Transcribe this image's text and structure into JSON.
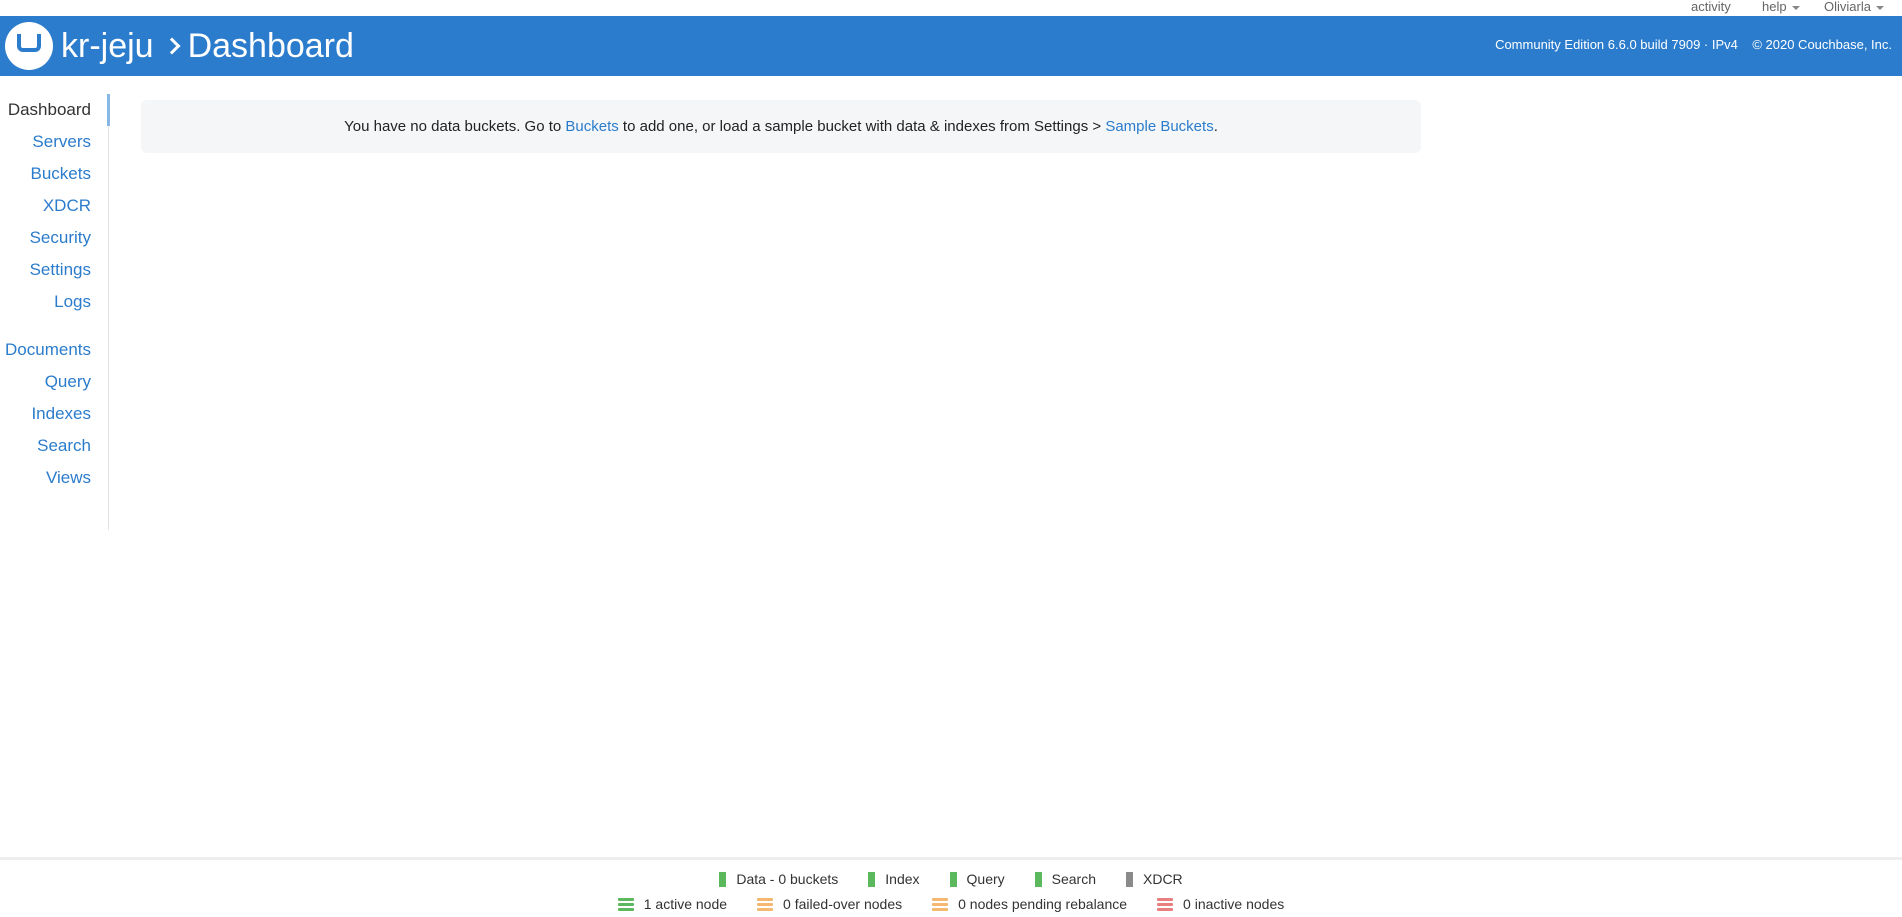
{
  "topbar": {
    "activity": "activity",
    "help": "help",
    "user": "Oliviarla"
  },
  "header": {
    "cluster_name": "kr-jeju",
    "page_title": "Dashboard",
    "version_info": "Community Edition 6.6.0 build 7909 · IPv4",
    "copyright": "© 2020 Couchbase, Inc.",
    "brand_color": "#2b7ccc"
  },
  "sidebar": {
    "group1": [
      {
        "label": "Dashboard",
        "active": true
      },
      {
        "label": "Servers"
      },
      {
        "label": "Buckets"
      },
      {
        "label": "XDCR"
      },
      {
        "label": "Security"
      },
      {
        "label": "Settings"
      },
      {
        "label": "Logs"
      }
    ],
    "group2": [
      {
        "label": "Documents"
      },
      {
        "label": "Query"
      },
      {
        "label": "Indexes"
      },
      {
        "label": "Search"
      },
      {
        "label": "Views"
      }
    ]
  },
  "alert": {
    "text_before": "You have no data buckets. Go to ",
    "link1": "Buckets",
    "text_middle": " to add one, or load a sample bucket with data & indexes from Settings > ",
    "link2": "Sample Buckets",
    "text_after": "."
  },
  "footer": {
    "services": [
      {
        "label": "Data - 0 buckets",
        "color": "#5cb85c"
      },
      {
        "label": "Index",
        "color": "#5cb85c"
      },
      {
        "label": "Query",
        "color": "#5cb85c"
      },
      {
        "label": "Search",
        "color": "#5cb85c"
      },
      {
        "label": "XDCR",
        "color": "#8a8a8a"
      }
    ],
    "nodes": [
      {
        "label": "1 active node",
        "color": "#5cb85c"
      },
      {
        "label": "0 failed-over nodes",
        "color": "#f5b870"
      },
      {
        "label": "0 nodes pending rebalance",
        "color": "#f5b870"
      },
      {
        "label": "0 inactive nodes",
        "color": "#e88080"
      }
    ]
  }
}
